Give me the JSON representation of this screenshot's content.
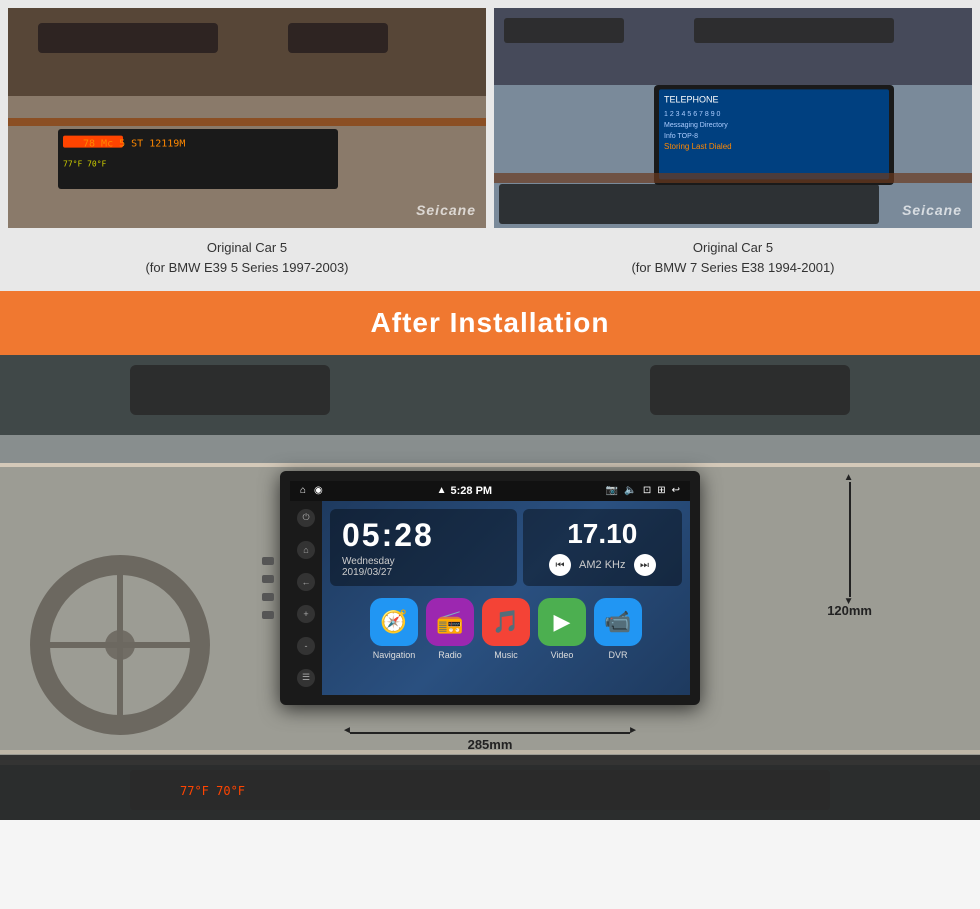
{
  "page": {
    "background_color": "#f5f5f5"
  },
  "original_cars": {
    "car1": {
      "caption_line1": "Original Car 5",
      "caption_line2": "(for BMW E39 5 Series 1997-2003)"
    },
    "car2": {
      "caption_line1": "Original Car 5",
      "caption_line2": "(for BMW 7 Series E38 1994-2001)"
    }
  },
  "after_installation": {
    "banner_text": "After Installation",
    "banner_bg": "#f07830"
  },
  "android_screen": {
    "status_bar": {
      "home_icon": "⌂",
      "location_icon": "◉",
      "time": "5:28 PM",
      "camera_icon": "📷",
      "volume_icon": "🔊",
      "fullscreen_icon": "⊞",
      "record_icon": "⊡",
      "back_icon": "↩"
    },
    "clock_widget": {
      "time": "05:28",
      "day": "Wednesday",
      "date": "2019/03/27"
    },
    "radio_widget": {
      "frequency": "17.10",
      "band": "AM2",
      "unit": "KHz"
    },
    "app_icons": [
      {
        "label": "Navigation",
        "color": "#2196F3",
        "icon": "🧭"
      },
      {
        "label": "Radio",
        "color": "#9C27B0",
        "icon": "📻"
      },
      {
        "label": "Music",
        "color": "#F44336",
        "icon": "🎵"
      },
      {
        "label": "Video",
        "color": "#4CAF50",
        "icon": "▶"
      },
      {
        "label": "DVR",
        "color": "#2196F3",
        "icon": "📹"
      }
    ]
  },
  "dimensions": {
    "width_label": "285mm",
    "height_label": "120mm"
  },
  "watermark": {
    "text": "Seicane"
  }
}
